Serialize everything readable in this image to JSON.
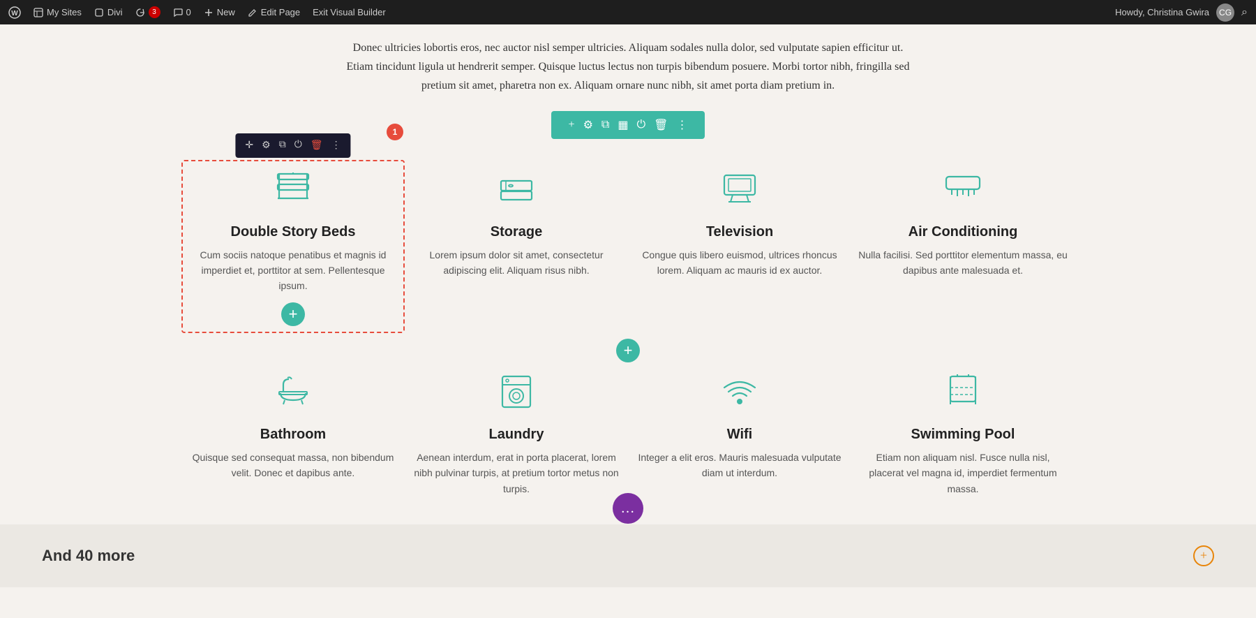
{
  "adminBar": {
    "wpIconLabel": "WordPress",
    "mySites": "My Sites",
    "divi": "Divi",
    "updates": "3",
    "comments": "0",
    "new": "New",
    "editPage": "Edit Page",
    "exitBuilder": "Exit Visual Builder",
    "howdy": "Howdy, Christina Gwira"
  },
  "textBlock": {
    "paragraph": "Donec ultricies lobortis eros, nec auctor nisl semper ultricies. Aliquam sodales nulla dolor, sed vulputate sapien efficitur ut. Etiam tincidunt ligula ut hendrerit semper. Quisque luctus lectus non turpis bibendum posuere. Morbi tortor nibh, fringilla sed pretium sit amet, pharetra non ex. Aliquam ornare nunc nibh, sit amet porta diam pretium in."
  },
  "features": [
    {
      "id": "double-story-beds",
      "title": "Double Story Beds",
      "desc": "Cum sociis natoque penatibus et magnis id imperdiet et, porttitor at sem. Pellentesque ipsum.",
      "icon": "bunk-bed"
    },
    {
      "id": "storage",
      "title": "Storage",
      "desc": "Lorem ipsum dolor sit amet, consectetur adipiscing elit. Aliquam risus nibh.",
      "icon": "storage"
    },
    {
      "id": "television",
      "title": "Television",
      "desc": "Congue quis libero euismod, ultrices rhoncus lorem. Aliquam ac mauris id ex auctor.",
      "icon": "tv"
    },
    {
      "id": "air-conditioning",
      "title": "Air Conditioning",
      "desc": "Nulla facilisi. Sed porttitor elementum massa, eu dapibus ante malesuada et.",
      "icon": "ac"
    },
    {
      "id": "bathroom",
      "title": "Bathroom",
      "desc": "Quisque sed consequat massa, non bibendum velit. Donec et dapibus ante.",
      "icon": "bath"
    },
    {
      "id": "laundry",
      "title": "Laundry",
      "desc": "Aenean interdum, erat in porta placerat, lorem nibh pulvinar turpis, at pretium tortor metus non turpis.",
      "icon": "laundry"
    },
    {
      "id": "wifi",
      "title": "Wifi",
      "desc": "Integer a elit eros. Mauris malesuada vulputate diam ut interdum.",
      "icon": "wifi"
    },
    {
      "id": "swimming-pool",
      "title": "Swimming Pool",
      "desc": "Etiam non aliquam nisl. Fusce nulla nisl, placerat vel magna id, imperdiet fermentum massa.",
      "icon": "pool"
    }
  ],
  "andMore": {
    "label": "And 40 more"
  },
  "notification": {
    "badge": "1"
  },
  "colors": {
    "teal": "#3db8a4",
    "dark": "#1a1a2e",
    "red": "#e74c3c",
    "purple": "#7b2fa0",
    "orange": "#e8850a"
  }
}
